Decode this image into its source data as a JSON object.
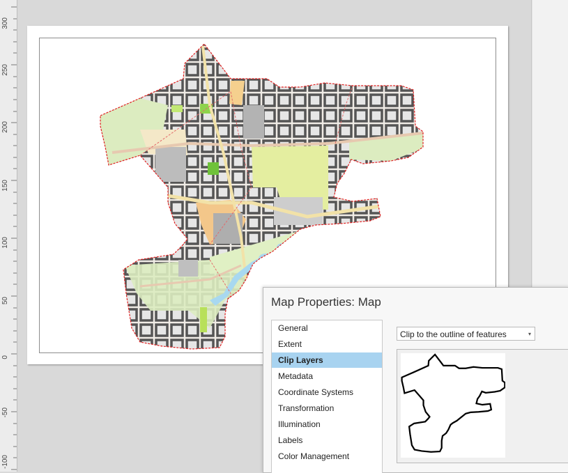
{
  "ruler": {
    "labels": [
      "300",
      "250",
      "200",
      "150",
      "100",
      "50",
      "0",
      "-50",
      "-100"
    ]
  },
  "dialog": {
    "title": "Map Properties: Map",
    "nav_items": [
      "General",
      "Extent",
      "Clip Layers",
      "Metadata",
      "Coordinate Systems",
      "Transformation",
      "Illumination",
      "Labels",
      "Color Management"
    ],
    "selected_index": 2,
    "clip_option": "Clip to the outline of features",
    "dropdown_glyph": "▾"
  },
  "colors": {
    "selection": "#a8d3f0",
    "clip_outline": "#e02020",
    "park": "#dcecc0",
    "campus": "#e4eea0",
    "roads": "#5a5a5a",
    "buildings": "#cfcfcf",
    "water": "#a8d8f0"
  }
}
